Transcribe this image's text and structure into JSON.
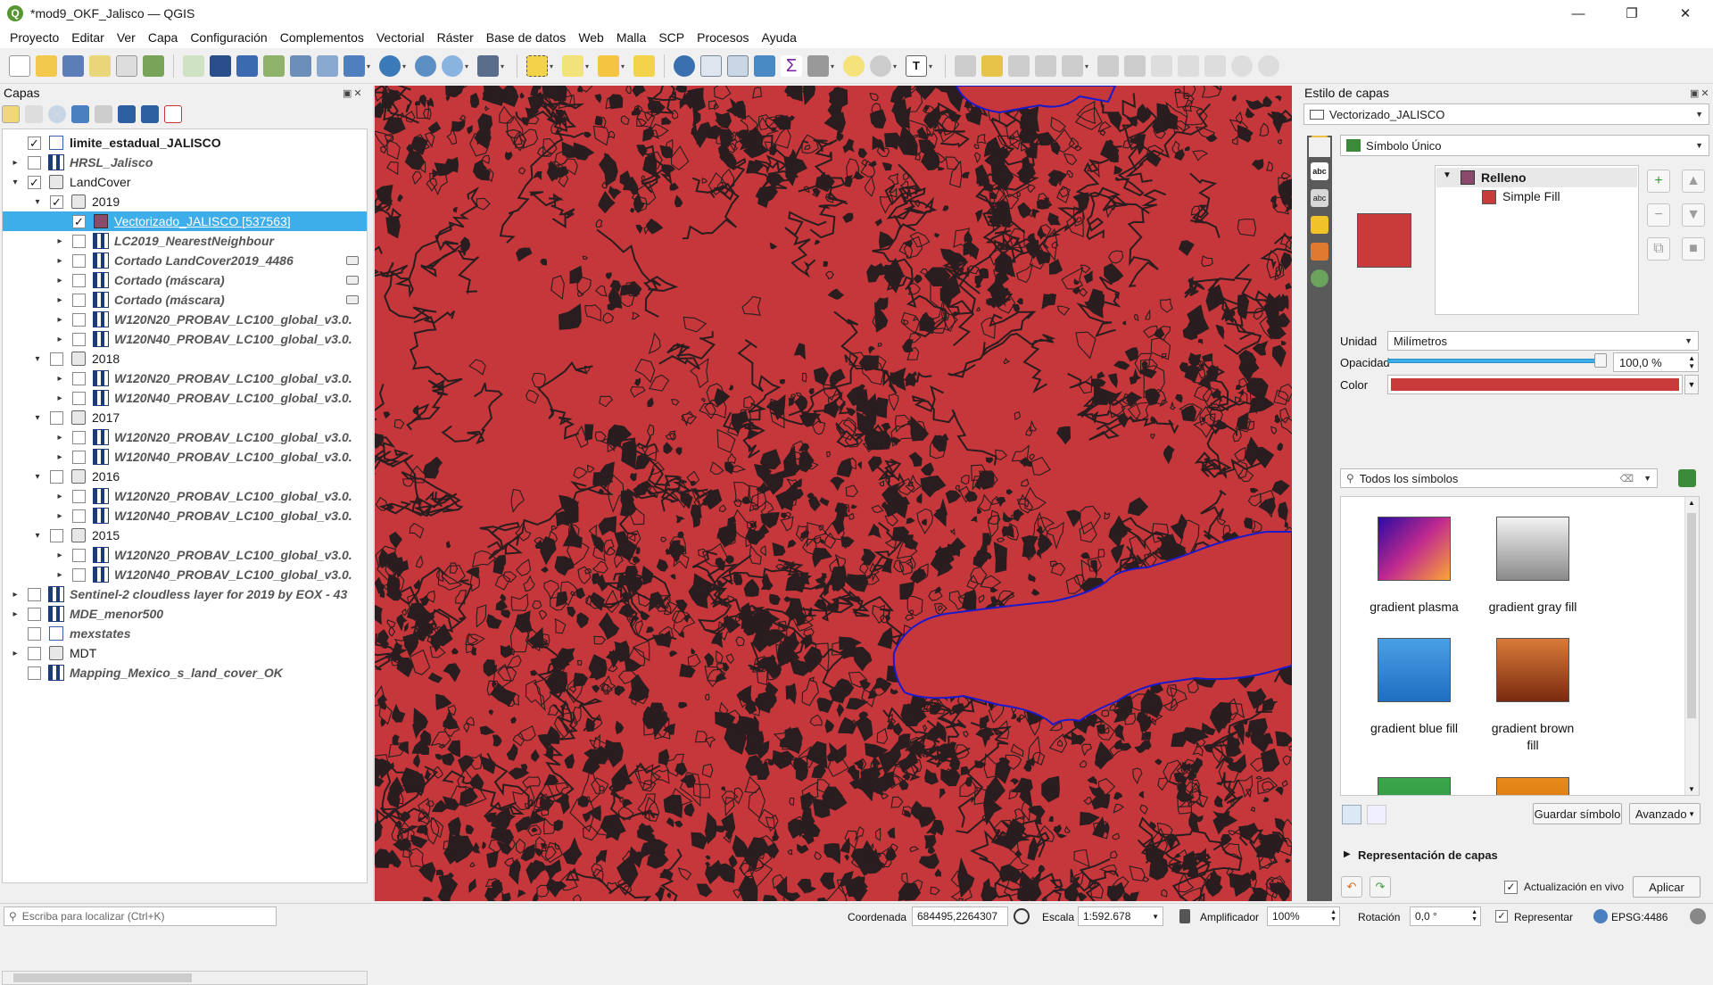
{
  "window": {
    "title": "*mod9_OKF_Jalisco — QGIS",
    "logo_letter": "Q",
    "minimize": "—",
    "restore": "❐",
    "close": "✕"
  },
  "menu": [
    "Proyecto",
    "Editar",
    "Ver",
    "Capa",
    "Configuración",
    "Complementos",
    "Vectorial",
    "Ráster",
    "Base de datos",
    "Web",
    "Malla",
    "SCP",
    "Procesos",
    "Ayuda"
  ],
  "layers_panel": {
    "title": "Capas",
    "layers": [
      {
        "label": "limite_estadual_JALISCO",
        "checked": true,
        "expander": "",
        "icon": "vec",
        "style": "bold"
      },
      {
        "label": "HRSL_Jalisco",
        "checked": false,
        "expander": "▸",
        "icon": "raster",
        "style": "ital"
      },
      {
        "label": "LandCover",
        "checked": true,
        "expander": "▾",
        "icon": "group",
        "style": "normal"
      },
      {
        "label": "2019",
        "checked": true,
        "expander": "▾",
        "icon": "group",
        "style": "normal"
      },
      {
        "label": "Vectorizado_JALISCO [537563]",
        "checked": true,
        "expander": "",
        "icon": "vecsel",
        "style": "selected"
      },
      {
        "label": "LC2019_NearestNeighbour",
        "checked": false,
        "expander": "▸",
        "icon": "raster",
        "style": "ital"
      },
      {
        "label": "Cortado LandCover2019_4486",
        "checked": false,
        "expander": "▸",
        "icon": "raster",
        "style": "ital",
        "embed": true
      },
      {
        "label": "Cortado (máscara)",
        "checked": false,
        "expander": "▸",
        "icon": "raster",
        "style": "ital",
        "embed": true
      },
      {
        "label": "Cortado (máscara)",
        "checked": false,
        "expander": "▸",
        "icon": "raster",
        "style": "ital",
        "embed": true
      },
      {
        "label": "W120N20_PROBAV_LC100_global_v3.0.",
        "checked": false,
        "expander": "▸",
        "icon": "raster",
        "style": "ital"
      },
      {
        "label": "W120N40_PROBAV_LC100_global_v3.0.",
        "checked": false,
        "expander": "▸",
        "icon": "raster",
        "style": "ital"
      },
      {
        "label": "2018",
        "checked": false,
        "expander": "▾",
        "icon": "group",
        "style": "normal"
      },
      {
        "label": "W120N20_PROBAV_LC100_global_v3.0.",
        "checked": false,
        "expander": "▸",
        "icon": "raster",
        "style": "ital"
      },
      {
        "label": "W120N40_PROBAV_LC100_global_v3.0.",
        "checked": false,
        "expander": "▸",
        "icon": "raster",
        "style": "ital"
      },
      {
        "label": "2017",
        "checked": false,
        "expander": "▾",
        "icon": "group",
        "style": "normal"
      },
      {
        "label": "W120N20_PROBAV_LC100_global_v3.0.",
        "checked": false,
        "expander": "▸",
        "icon": "raster",
        "style": "ital"
      },
      {
        "label": "W120N40_PROBAV_LC100_global_v3.0.",
        "checked": false,
        "expander": "▸",
        "icon": "raster",
        "style": "ital"
      },
      {
        "label": "2016",
        "checked": false,
        "expander": "▾",
        "icon": "group",
        "style": "normal"
      },
      {
        "label": "W120N20_PROBAV_LC100_global_v3.0.",
        "checked": false,
        "expander": "▸",
        "icon": "raster",
        "style": "ital"
      },
      {
        "label": "W120N40_PROBAV_LC100_global_v3.0.",
        "checked": false,
        "expander": "▸",
        "icon": "raster",
        "style": "ital"
      },
      {
        "label": "2015",
        "checked": false,
        "expander": "▾",
        "icon": "group",
        "style": "normal"
      },
      {
        "label": "W120N20_PROBAV_LC100_global_v3.0.",
        "checked": false,
        "expander": "▸",
        "icon": "raster",
        "style": "ital"
      },
      {
        "label": "W120N40_PROBAV_LC100_global_v3.0.",
        "checked": false,
        "expander": "▸",
        "icon": "raster",
        "style": "ital"
      },
      {
        "label": "Sentinel-2 cloudless layer for 2019 by EOX - 43",
        "checked": false,
        "expander": "▸",
        "icon": "raster",
        "style": "ital"
      },
      {
        "label": "MDE_menor500",
        "checked": false,
        "expander": "▸",
        "icon": "raster",
        "style": "ital"
      },
      {
        "label": "mexstates",
        "checked": false,
        "expander": "",
        "icon": "vec",
        "style": "ital"
      },
      {
        "label": "MDT",
        "checked": false,
        "expander": "▸",
        "icon": "group",
        "style": "normal"
      },
      {
        "label": "Mapping_Mexico_s_land_cover_OK",
        "checked": false,
        "expander": "",
        "icon": "raster",
        "style": "ital"
      }
    ]
  },
  "style_panel": {
    "title": "Estilo de capas",
    "layer_select": "Vectorizado_JALISCO",
    "renderer": "Símbolo Único",
    "symbol_tree": {
      "root": "Relleno",
      "child": "Simple Fill"
    },
    "unit_label": "Unidad",
    "unit_value": "Milímetros",
    "opacity_label": "Opacidad",
    "opacity_value": "100,0 %",
    "opacity_fraction": 1.0,
    "color_label": "Color",
    "fill_color": "#c93b3b",
    "search_placeholder": "Todos los símbolos",
    "symbols": [
      {
        "name": "gradient  plasma",
        "colors": [
          "#2b0aa0",
          "#c12a8f",
          "#f9a635"
        ]
      },
      {
        "name": "gradient  gray fill",
        "colors": [
          "#f2f2f2",
          "#8a8a8a"
        ]
      },
      {
        "name": "gradient blue fill",
        "colors": [
          "#4aa0e6",
          "#1e6fc0"
        ]
      },
      {
        "name": "gradient brown fill",
        "colors": [
          "#d97a3a",
          "#7a2a10"
        ]
      },
      {
        "name": "",
        "colors": [
          "#3aa64a",
          "#2d8f3c"
        ]
      },
      {
        "name": "",
        "colors": [
          "#e88a1a",
          "#c86a08"
        ]
      }
    ],
    "save_symbol": "Guardar símbolo",
    "advanced": "Avanzado",
    "layer_rendering": "Representación de capas",
    "live_update": "Actualización en vivo",
    "apply": "Aplicar"
  },
  "statusbar": {
    "locator_placeholder": "Escriba para localizar (Ctrl+K)",
    "coord_label": "Coordenada",
    "coord_value": "684495,2264307",
    "scale_label": "Escala",
    "scale_value": "1:592.678",
    "magnifier_label": "Amplificador",
    "magnifier_value": "100%",
    "rotation_label": "Rotación",
    "rotation_value": "0,0 °",
    "render_label": "Representar",
    "crs": "EPSG:4486"
  },
  "colors": {
    "map_fill": "#c5373a",
    "boundary": "#1a1acc",
    "selection": "#3daee9",
    "outline": "#2a1d1f"
  }
}
